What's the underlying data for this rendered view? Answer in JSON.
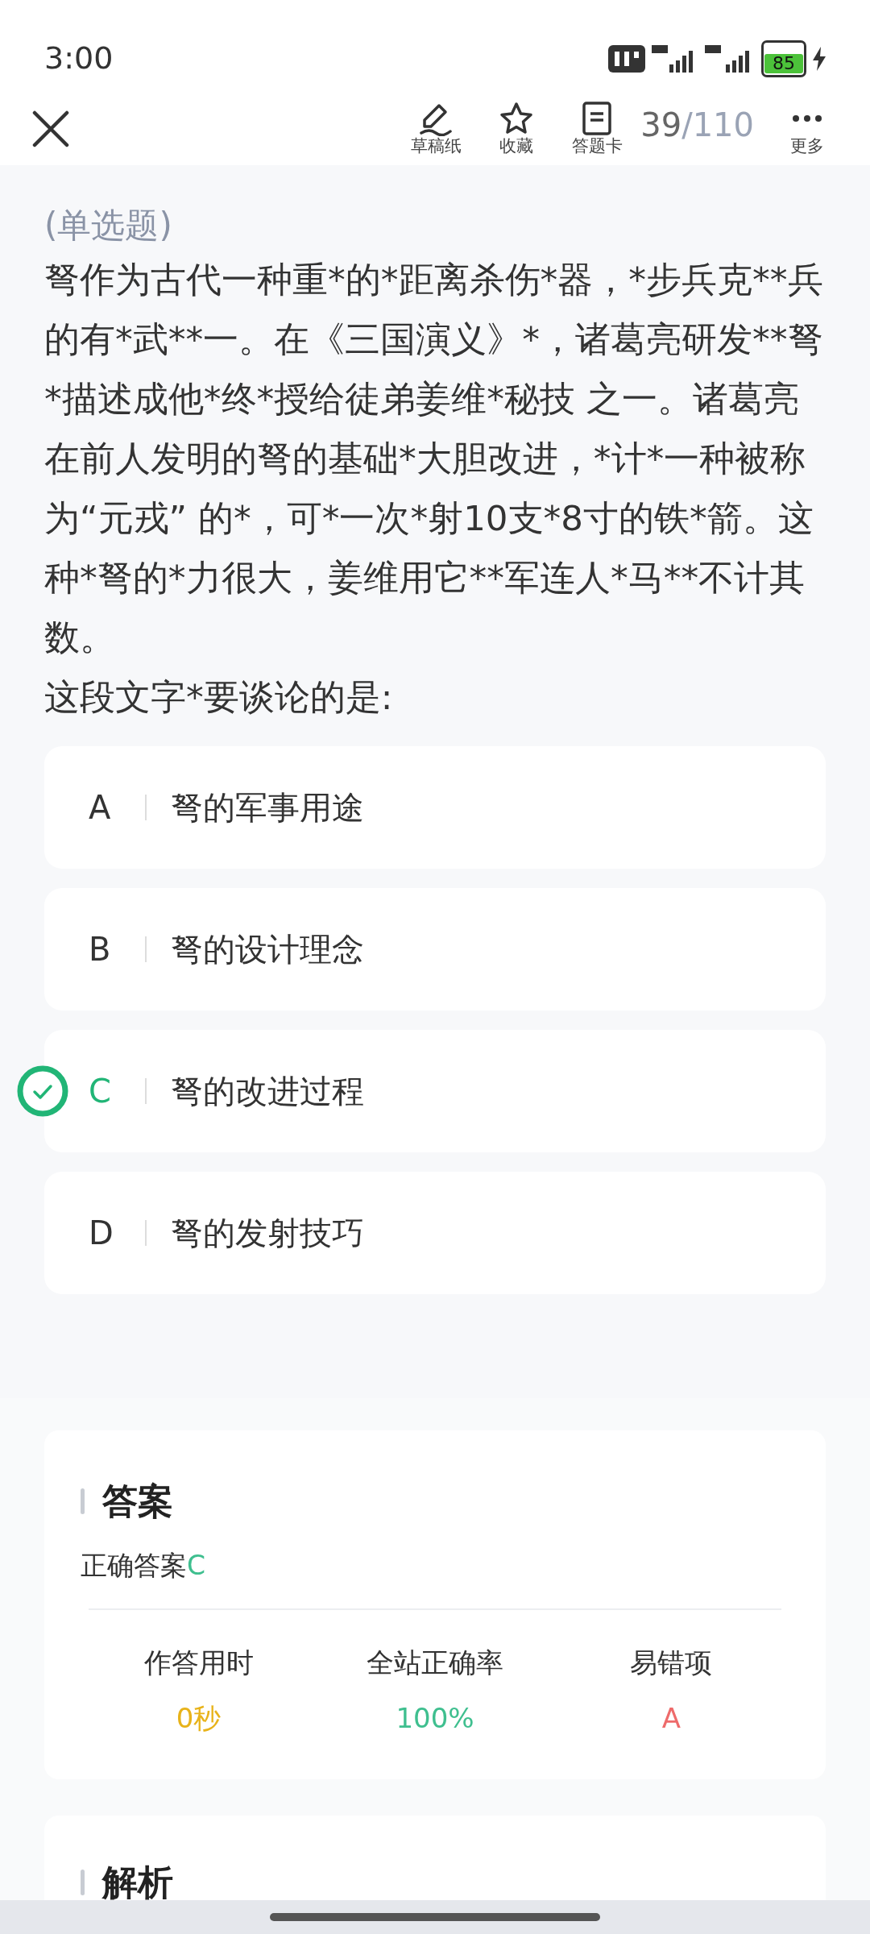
{
  "status_bar": {
    "time": "3:00",
    "battery": "85"
  },
  "toolbar": {
    "tools": [
      {
        "kind": "draft",
        "label": "草稿纸"
      },
      {
        "kind": "favorite",
        "label": "收藏"
      },
      {
        "kind": "answer_sheet",
        "label": "答题卡"
      }
    ],
    "current": "39",
    "total": "/110",
    "more": {
      "label": "更多"
    }
  },
  "question": {
    "type": "(单选题)",
    "text": "弩作为古代一种重*的*距离杀伤*器，*步兵克**兵的有*武**一。在《三国演义》*，诸葛亮研发**弩*描述成他*终*授给徒弟姜维*秘技 之一。诸葛亮在前人发明的弩的基础*大胆改进，*计*一种被称为“元戎” 的*，可*一次*射10支*8寸的铁*箭。这种*弩的*力很大，姜维用它**军连人*马**不计其数。",
    "prompt": "这段文字*要谈论的是:"
  },
  "options": [
    {
      "letter": "A",
      "text": "弩的军事用途",
      "selected": false
    },
    {
      "letter": "B",
      "text": "弩的设计理念",
      "selected": false
    },
    {
      "letter": "C",
      "text": "弩的改进过程",
      "selected": true
    },
    {
      "letter": "D",
      "text": "弩的发射技巧",
      "selected": false
    }
  ],
  "answer": {
    "heading": "答案",
    "label": "正确答案",
    "value": "C",
    "stats": [
      {
        "label": "作答用时",
        "value": "0秒",
        "color": "#e8b31a"
      },
      {
        "label": "全站正确率",
        "value": "100%",
        "color": "#3fbf8f"
      },
      {
        "label": "易错项",
        "value": "A",
        "color": "#ee6b6b"
      }
    ]
  },
  "analysis": {
    "heading": "解析"
  }
}
